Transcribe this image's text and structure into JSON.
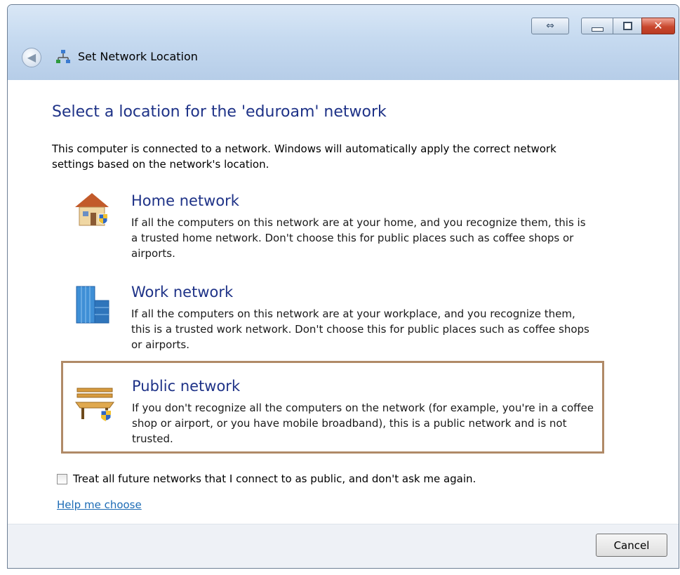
{
  "window": {
    "title": "Set Network Location",
    "controls": {
      "resize_icon": "resize-arrows-icon",
      "minimize_icon": "minimize-icon",
      "maximize_icon": "maximize-icon",
      "close_icon": "close-icon"
    }
  },
  "main": {
    "heading": "Select a location for the 'eduroam' network",
    "description": "This computer is connected to a network. Windows will automatically apply the correct network settings based on the network's location.",
    "options": [
      {
        "title": "Home network",
        "body": "If all the computers on this network are at your home, and you recognize them, this is a trusted home network.  Don't choose this for public places such as coffee shops or airports.",
        "icon": "house-icon"
      },
      {
        "title": "Work network",
        "body": "If all the computers on this network are at your workplace, and you recognize them, this is a trusted work network.  Don't choose this for public places such as coffee shops or airports.",
        "icon": "office-building-icon"
      },
      {
        "title": "Public network",
        "body": "If you don't recognize all the computers on the network (for example, you're in a coffee shop or airport, or you have mobile broadband), this is a public network and is not trusted.",
        "icon": "park-bench-icon"
      }
    ],
    "checkbox_label": "Treat all future networks that I connect to as public, and don't ask me again.",
    "checkbox_checked": false,
    "help_link": "Help me choose"
  },
  "footer": {
    "cancel_label": "Cancel"
  },
  "colors": {
    "heading": "#1e3287",
    "link": "#1c6bb5",
    "selected_border": "#b08a67"
  }
}
